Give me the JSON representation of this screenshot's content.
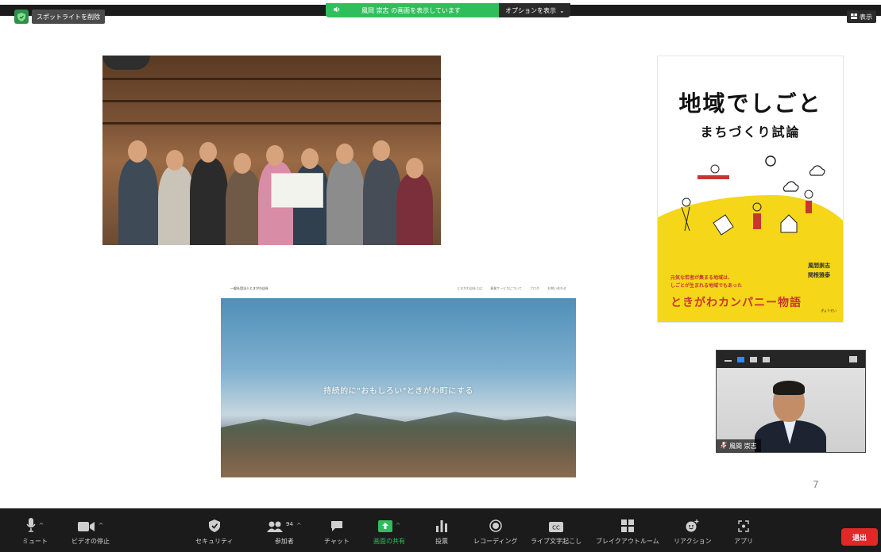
{
  "top": {
    "spotlight_label": "スポットライトを削除",
    "share_banner_text": "風岡 崇志 の画面を表示しています",
    "options_label": "オプションを表示",
    "view_label": "表示"
  },
  "book": {
    "title": "地域でしごと",
    "subtitle": "まちづくり試論",
    "author1": "風間崇志",
    "author2": "関根雅泰",
    "description_line1": "元気な若者が集まる地域は、",
    "description_line2": "しごとが生まれる地域でもあった",
    "bottom_title": "ときがわカンパニー物語",
    "publisher": "ぎょうせい"
  },
  "website": {
    "brand": "一般社団法人ときがわ自社",
    "nav_items": [
      "ときがわ自社とは",
      "事業サービスについて",
      "ブログ",
      "お問い合わせ"
    ],
    "tagline": "持続的に\"おもしろい\"ときがわ町にする"
  },
  "video": {
    "participant_name": "風間 崇志"
  },
  "slide": {
    "page_number": "7"
  },
  "toolbar": {
    "mute": "ミュート",
    "video": "ビデオの停止",
    "security": "セキュリティ",
    "participants": "参加者",
    "participants_count": "94",
    "chat": "チャット",
    "share": "画面の共有",
    "polls": "投票",
    "recording": "レコーディング",
    "captions": "ライブ文字起こし",
    "breakout": "ブレイクアウトルーム",
    "reactions": "リアクション",
    "apps": "アプリ",
    "leave": "退出"
  },
  "colors": {
    "share_green": "#2fbf5a",
    "leave_red": "#e02828",
    "toolbar_bg": "#1b1b1b",
    "book_yellow": "#f5d619",
    "book_red": "#c7372f"
  }
}
